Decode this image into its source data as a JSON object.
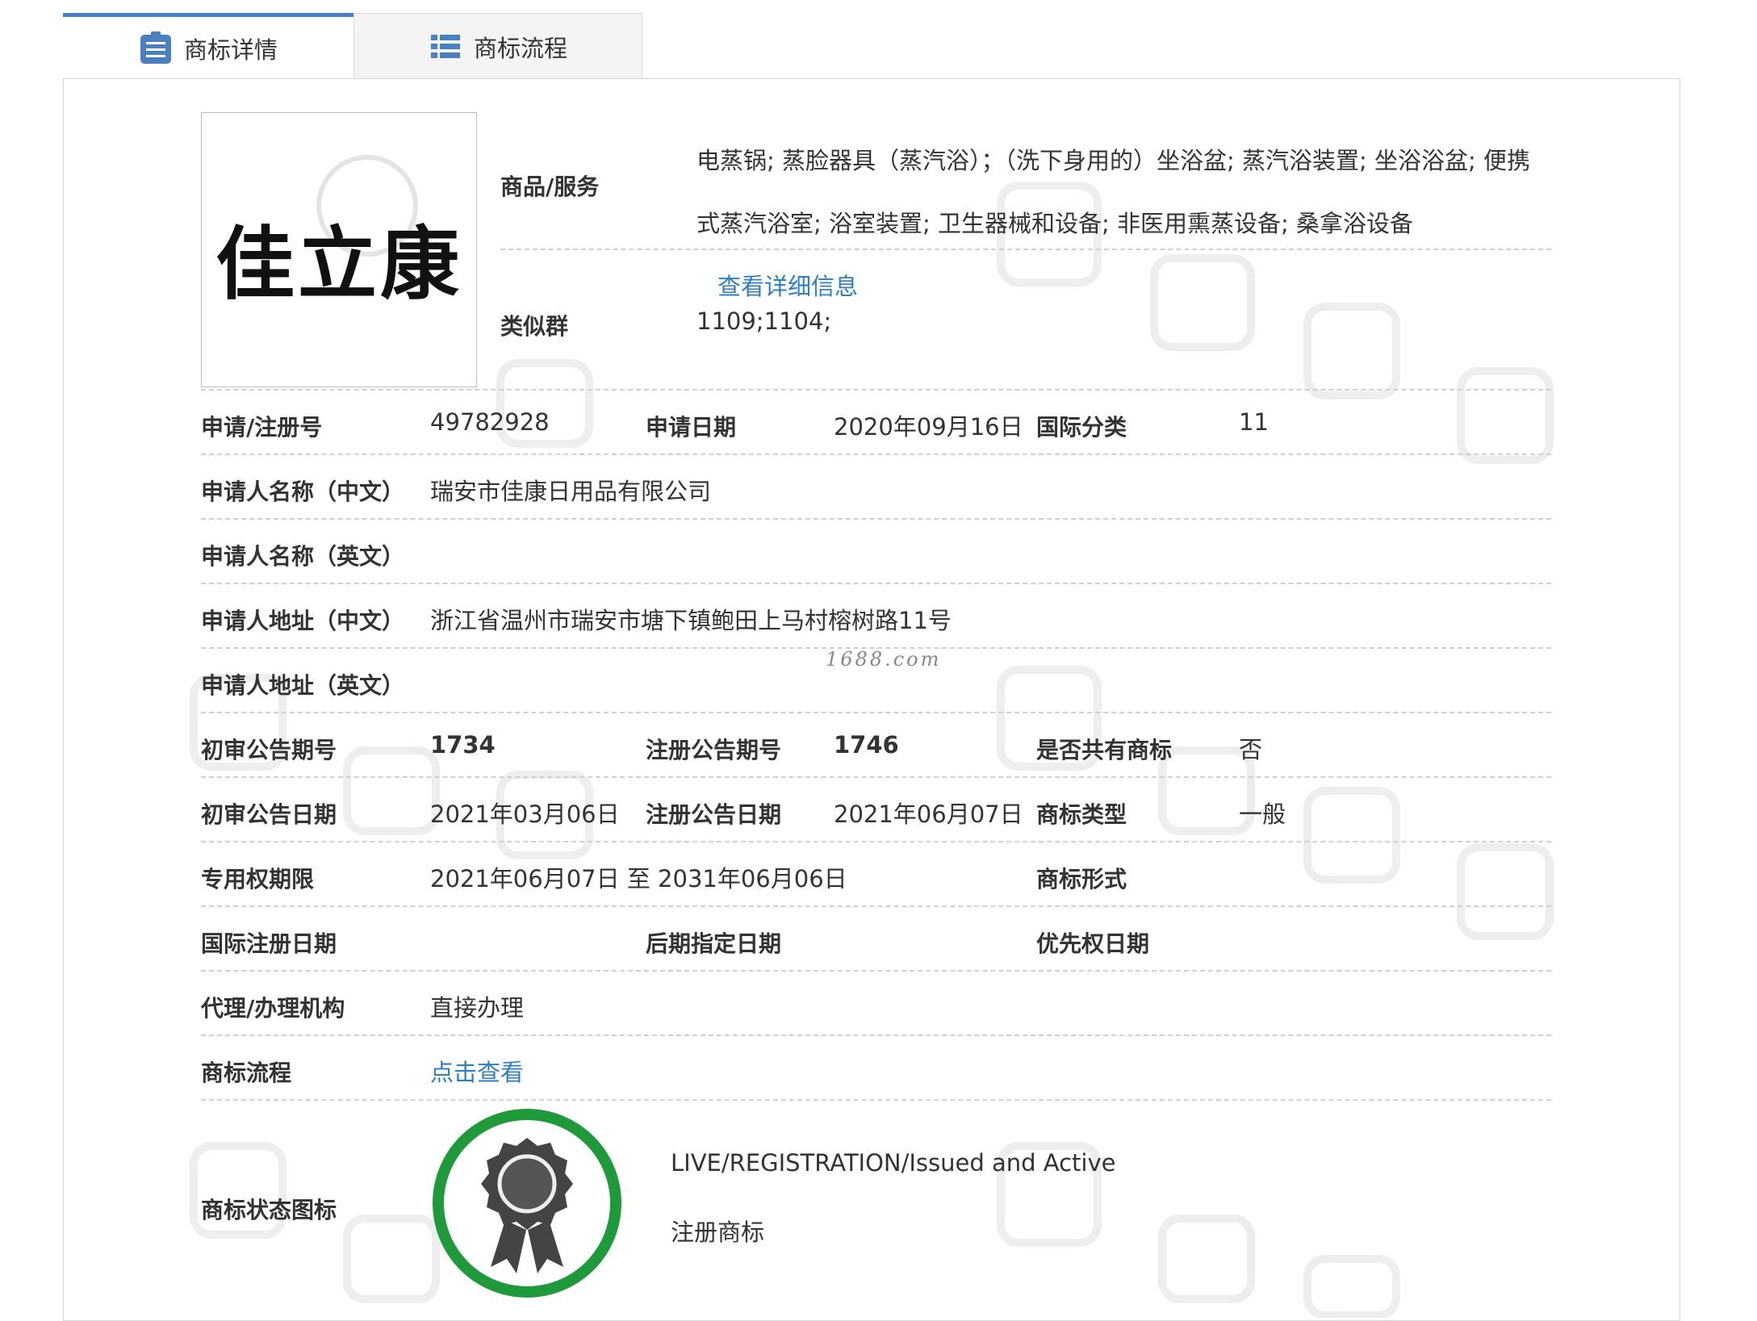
{
  "tabs": {
    "detail": "商标详情",
    "flow": "商标流程"
  },
  "logo": {
    "text": "佳立康"
  },
  "goods": {
    "label": "商品/服务",
    "value": "电蒸锅; 蒸脸器具（蒸汽浴）；（洗下身用的）坐浴盆; 蒸汽浴装置; 坐浴浴盆; 便携式蒸汽浴室; 浴室装置; 卫生器械和设备; 非医用熏蒸设备; 桑拿浴设备",
    "link": "查看详细信息"
  },
  "similar_group": {
    "label": "类似群",
    "value": "1109;1104;"
  },
  "fields": {
    "reg_no": {
      "label": "申请/注册号",
      "value": "49782928"
    },
    "apply_date": {
      "label": "申请日期",
      "value": "2020年09月16日"
    },
    "intl_class": {
      "label": "国际分类",
      "value": "11"
    },
    "applicant_cn": {
      "label": "申请人名称（中文）",
      "value": "瑞安市佳康日用品有限公司"
    },
    "applicant_en": {
      "label": "申请人名称（英文）",
      "value": ""
    },
    "address_cn": {
      "label": "申请人地址（中文）",
      "value": "浙江省温州市瑞安市塘下镇鲍田上马村榕树路11号"
    },
    "address_en": {
      "label": "申请人地址（英文）",
      "value": ""
    },
    "prelim_issue": {
      "label": "初审公告期号",
      "value": "1734"
    },
    "reg_issue": {
      "label": "注册公告期号",
      "value": "1746"
    },
    "shared": {
      "label": "是否共有商标",
      "value": "否"
    },
    "prelim_date": {
      "label": "初审公告日期",
      "value": "2021年03月06日"
    },
    "reg_date": {
      "label": "注册公告日期",
      "value": "2021年06月07日"
    },
    "tm_type": {
      "label": "商标类型",
      "value": "一般"
    },
    "exclusive_period": {
      "label": "专用权期限",
      "value": "2021年06月07日 至 2031年06月06日"
    },
    "tm_form": {
      "label": "商标形式",
      "value": ""
    },
    "intl_reg_date": {
      "label": "国际注册日期",
      "value": ""
    },
    "later_designation": {
      "label": "后期指定日期",
      "value": ""
    },
    "priority_date": {
      "label": "优先权日期",
      "value": ""
    },
    "agency": {
      "label": "代理/办理机构",
      "value": "直接办理"
    },
    "tm_flow": {
      "label": "商标流程",
      "value": "点击查看"
    }
  },
  "status": {
    "label": "商标状态图标",
    "line1": "LIVE/REGISTRATION/Issued and Active",
    "line2": "注册商标"
  },
  "site_watermark": "1688.com",
  "colors": {
    "link": "#2c7fc4",
    "tab_accent": "#4a7fc1",
    "badge_ring": "#1f9a3a",
    "badge_medal": "#444444"
  },
  "icons": {
    "detail_tab": "document-list-icon",
    "flow_tab": "list-icon",
    "status": "award-ribbon-icon"
  }
}
